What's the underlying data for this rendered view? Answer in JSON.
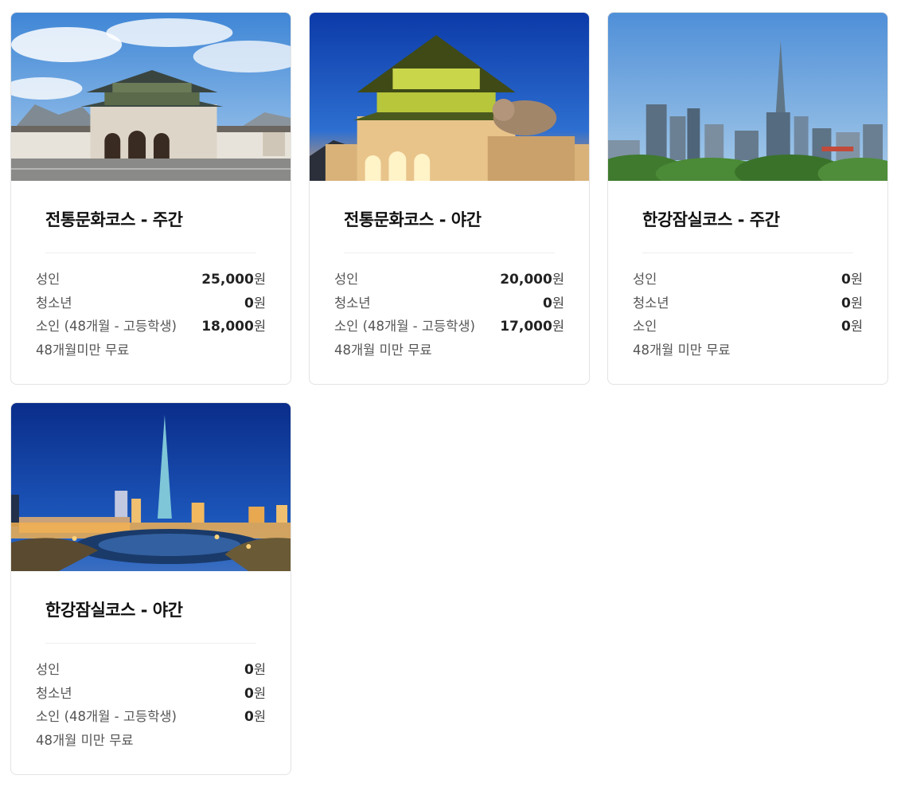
{
  "cards": [
    {
      "title": "전통문화코스 - 주간",
      "image_icon": "palace-day-photo",
      "prices": [
        {
          "label": "성인",
          "amount": "25,000",
          "unit": "원"
        },
        {
          "label": "청소년",
          "amount": "0",
          "unit": "원"
        },
        {
          "label": "소인 (48개월 - 고등학생)",
          "amount": "18,000",
          "unit": "원"
        }
      ],
      "note": "48개월미만 무료"
    },
    {
      "title": "전통문화코스 - 야간",
      "image_icon": "palace-night-photo",
      "prices": [
        {
          "label": "성인",
          "amount": "20,000",
          "unit": "원"
        },
        {
          "label": "청소년",
          "amount": "0",
          "unit": "원"
        },
        {
          "label": "소인 (48개월 - 고등학생)",
          "amount": "17,000",
          "unit": "원"
        }
      ],
      "note": "48개월 미만 무료"
    },
    {
      "title": "한강잠실코스 - 주간",
      "image_icon": "skyline-day-photo",
      "prices": [
        {
          "label": "성인",
          "amount": "0",
          "unit": "원"
        },
        {
          "label": "청소년",
          "amount": "0",
          "unit": "원"
        },
        {
          "label": "소인",
          "amount": "0",
          "unit": "원"
        }
      ],
      "note": "48개월 미만 무료"
    },
    {
      "title": "한강잠실코스 - 야간",
      "image_icon": "skyline-night-photo",
      "prices": [
        {
          "label": "성인",
          "amount": "0",
          "unit": "원"
        },
        {
          "label": "청소년",
          "amount": "0",
          "unit": "원"
        },
        {
          "label": "소인 (48개월 - 고등학생)",
          "amount": "0",
          "unit": "원"
        }
      ],
      "note": "48개월 미만 무료"
    }
  ]
}
